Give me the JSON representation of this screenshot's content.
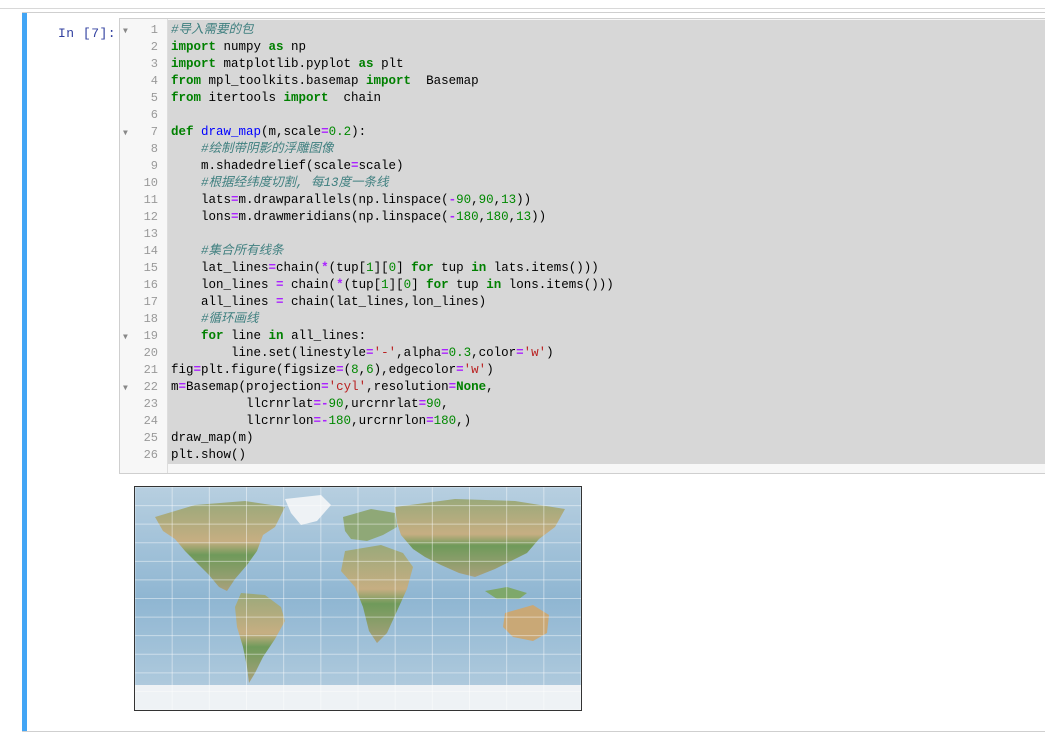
{
  "cell": {
    "prompt": "In  [7]:",
    "lines": [
      {
        "n": "1",
        "fold": true,
        "segments": [
          {
            "t": "#导入需要的包",
            "c": "cm"
          }
        ]
      },
      {
        "n": "2",
        "segments": [
          {
            "t": "import",
            "c": "kw"
          },
          {
            "t": " numpy "
          },
          {
            "t": "as",
            "c": "kw"
          },
          {
            "t": " np"
          }
        ]
      },
      {
        "n": "3",
        "segments": [
          {
            "t": "import",
            "c": "kw"
          },
          {
            "t": " matplotlib.pyplot "
          },
          {
            "t": "as",
            "c": "kw"
          },
          {
            "t": " plt"
          }
        ]
      },
      {
        "n": "4",
        "segments": [
          {
            "t": "from",
            "c": "kw"
          },
          {
            "t": " mpl_toolkits.basemap "
          },
          {
            "t": "import",
            "c": "kw"
          },
          {
            "t": "  Basemap"
          }
        ]
      },
      {
        "n": "5",
        "segments": [
          {
            "t": "from",
            "c": "kw"
          },
          {
            "t": " itertools "
          },
          {
            "t": "import",
            "c": "kw"
          },
          {
            "t": "  chain"
          }
        ]
      },
      {
        "n": "6",
        "segments": []
      },
      {
        "n": "7",
        "fold": true,
        "segments": [
          {
            "t": "def",
            "c": "kw"
          },
          {
            "t": " "
          },
          {
            "t": "draw_map",
            "c": "fn"
          },
          {
            "t": "(m,scale"
          },
          {
            "t": "=",
            "c": "op"
          },
          {
            "t": "0.2",
            "c": "nm"
          },
          {
            "t": "):"
          }
        ]
      },
      {
        "n": "8",
        "segments": [
          {
            "t": "    "
          },
          {
            "t": "#绘制带阴影的浮雕图像",
            "c": "cm"
          }
        ]
      },
      {
        "n": "9",
        "segments": [
          {
            "t": "    m.shadedrelief(scale"
          },
          {
            "t": "=",
            "c": "op"
          },
          {
            "t": "scale)"
          }
        ]
      },
      {
        "n": "10",
        "segments": [
          {
            "t": "    "
          },
          {
            "t": "#根据经纬度切割, 每13度一条线",
            "c": "cm"
          }
        ]
      },
      {
        "n": "11",
        "segments": [
          {
            "t": "    lats"
          },
          {
            "t": "=",
            "c": "op"
          },
          {
            "t": "m.drawparallels(np.linspace("
          },
          {
            "t": "-",
            "c": "op"
          },
          {
            "t": "90",
            "c": "nm"
          },
          {
            "t": ","
          },
          {
            "t": "90",
            "c": "nm"
          },
          {
            "t": ","
          },
          {
            "t": "13",
            "c": "nm"
          },
          {
            "t": "))"
          }
        ]
      },
      {
        "n": "12",
        "segments": [
          {
            "t": "    lons"
          },
          {
            "t": "=",
            "c": "op"
          },
          {
            "t": "m.drawmeridians(np.linspace("
          },
          {
            "t": "-",
            "c": "op"
          },
          {
            "t": "180",
            "c": "nm"
          },
          {
            "t": ","
          },
          {
            "t": "180",
            "c": "nm"
          },
          {
            "t": ","
          },
          {
            "t": "13",
            "c": "nm"
          },
          {
            "t": "))"
          }
        ]
      },
      {
        "n": "13",
        "segments": []
      },
      {
        "n": "14",
        "segments": [
          {
            "t": "    "
          },
          {
            "t": "#集合所有线条",
            "c": "cm"
          }
        ]
      },
      {
        "n": "15",
        "segments": [
          {
            "t": "    lat_lines"
          },
          {
            "t": "=",
            "c": "op"
          },
          {
            "t": "chain("
          },
          {
            "t": "*",
            "c": "op"
          },
          {
            "t": "(tup["
          },
          {
            "t": "1",
            "c": "nm"
          },
          {
            "t": "]["
          },
          {
            "t": "0",
            "c": "nm"
          },
          {
            "t": "] "
          },
          {
            "t": "for",
            "c": "kw"
          },
          {
            "t": " tup "
          },
          {
            "t": "in",
            "c": "kw"
          },
          {
            "t": " lats.items()))"
          }
        ]
      },
      {
        "n": "16",
        "segments": [
          {
            "t": "    lon_lines "
          },
          {
            "t": "=",
            "c": "op"
          },
          {
            "t": " chain("
          },
          {
            "t": "*",
            "c": "op"
          },
          {
            "t": "(tup["
          },
          {
            "t": "1",
            "c": "nm"
          },
          {
            "t": "]["
          },
          {
            "t": "0",
            "c": "nm"
          },
          {
            "t": "] "
          },
          {
            "t": "for",
            "c": "kw"
          },
          {
            "t": " tup "
          },
          {
            "t": "in",
            "c": "kw"
          },
          {
            "t": " lons.items()))"
          }
        ]
      },
      {
        "n": "17",
        "segments": [
          {
            "t": "    all_lines "
          },
          {
            "t": "=",
            "c": "op"
          },
          {
            "t": " chain(lat_lines,lon_lines)"
          }
        ]
      },
      {
        "n": "18",
        "segments": [
          {
            "t": "    "
          },
          {
            "t": "#循环画线",
            "c": "cm"
          }
        ]
      },
      {
        "n": "19",
        "fold": true,
        "segments": [
          {
            "t": "    "
          },
          {
            "t": "for",
            "c": "kw"
          },
          {
            "t": " line "
          },
          {
            "t": "in",
            "c": "kw"
          },
          {
            "t": " all_lines:"
          }
        ]
      },
      {
        "n": "20",
        "segments": [
          {
            "t": "        line.set(linestyle"
          },
          {
            "t": "=",
            "c": "op"
          },
          {
            "t": "'-'",
            "c": "st"
          },
          {
            "t": ",alpha"
          },
          {
            "t": "=",
            "c": "op"
          },
          {
            "t": "0.3",
            "c": "nm"
          },
          {
            "t": ",color"
          },
          {
            "t": "=",
            "c": "op"
          },
          {
            "t": "'w'",
            "c": "st"
          },
          {
            "t": ")"
          }
        ]
      },
      {
        "n": "21",
        "segments": [
          {
            "t": "fig"
          },
          {
            "t": "=",
            "c": "op"
          },
          {
            "t": "plt.figure(figsize"
          },
          {
            "t": "=",
            "c": "op"
          },
          {
            "t": "("
          },
          {
            "t": "8",
            "c": "nm"
          },
          {
            "t": ","
          },
          {
            "t": "6",
            "c": "nm"
          },
          {
            "t": "),edgecolor"
          },
          {
            "t": "=",
            "c": "op"
          },
          {
            "t": "'w'",
            "c": "st"
          },
          {
            "t": ")"
          }
        ]
      },
      {
        "n": "22",
        "fold": true,
        "segments": [
          {
            "t": "m"
          },
          {
            "t": "=",
            "c": "op"
          },
          {
            "t": "Basemap(projection"
          },
          {
            "t": "=",
            "c": "op"
          },
          {
            "t": "'cyl'",
            "c": "st"
          },
          {
            "t": ",resolution"
          },
          {
            "t": "=",
            "c": "op"
          },
          {
            "t": "None",
            "c": "kw"
          },
          {
            "t": ","
          }
        ]
      },
      {
        "n": "23",
        "segments": [
          {
            "t": "          llcrnrlat"
          },
          {
            "t": "=-",
            "c": "op"
          },
          {
            "t": "90",
            "c": "nm"
          },
          {
            "t": ",urcrnrlat"
          },
          {
            "t": "=",
            "c": "op"
          },
          {
            "t": "90",
            "c": "nm"
          },
          {
            "t": ","
          }
        ]
      },
      {
        "n": "24",
        "segments": [
          {
            "t": "          llcrnrlon"
          },
          {
            "t": "=-",
            "c": "op"
          },
          {
            "t": "180",
            "c": "nm"
          },
          {
            "t": ",urcrnrlon"
          },
          {
            "t": "=",
            "c": "op"
          },
          {
            "t": "180",
            "c": "nm"
          },
          {
            "t": ",)"
          }
        ]
      },
      {
        "n": "25",
        "segments": [
          {
            "t": "draw_map(m)"
          }
        ]
      },
      {
        "n": "26",
        "segments": [
          {
            "t": "plt.show()"
          }
        ]
      }
    ]
  },
  "colors": {
    "cell_bar": "#42a5f5",
    "ocean": "#9dc0d6",
    "land_green": "#7ea86a",
    "land_desert": "#c9b48a",
    "ice": "#f2f5f8",
    "grid": "#ffffff"
  }
}
